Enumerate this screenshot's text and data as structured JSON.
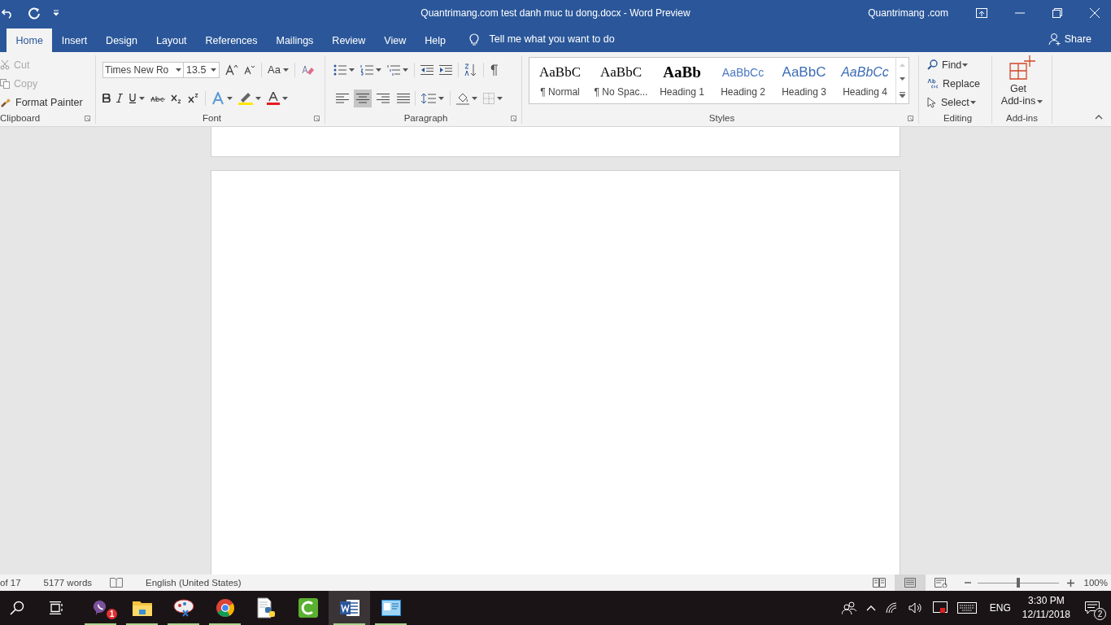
{
  "title_bar": {
    "title": "Quantrimang.com test danh muc tu dong.docx  -  Word Preview",
    "user": "Quantrimang .com"
  },
  "tabs": [
    {
      "label": "Home",
      "selected": true
    },
    {
      "label": "Insert",
      "selected": false
    },
    {
      "label": "Design",
      "selected": false
    },
    {
      "label": "Layout",
      "selected": false
    },
    {
      "label": "References",
      "selected": false
    },
    {
      "label": "Mailings",
      "selected": false
    },
    {
      "label": "Review",
      "selected": false
    },
    {
      "label": "View",
      "selected": false
    },
    {
      "label": "Help",
      "selected": false
    }
  ],
  "tell_me": "Tell me what you want to do",
  "share": "Share",
  "clipboard": {
    "label": "Clipboard",
    "items": [
      {
        "kind": "cut",
        "label": "Cut",
        "disabled": true
      },
      {
        "kind": "copy",
        "label": "Copy",
        "disabled": true
      },
      {
        "kind": "painter",
        "label": "Format Painter",
        "disabled": false
      }
    ]
  },
  "font": {
    "label": "Font",
    "font_name": "Times New Ro",
    "font_size": "13.5",
    "change_case": "Aa"
  },
  "paragraph": {
    "label": "Paragraph",
    "alignments": [
      {
        "selected": false
      },
      {
        "selected": true
      },
      {
        "selected": false
      },
      {
        "selected": false
      }
    ]
  },
  "styles": {
    "label": "Styles",
    "items": [
      {
        "kind": "normal",
        "preview": "AaBbC",
        "label": "¶ Normal"
      },
      {
        "kind": "normal",
        "preview": "AaBbC",
        "label": "¶ No Spac..."
      },
      {
        "kind": "heading1",
        "preview": "AaBb",
        "label": "Heading 1"
      },
      {
        "kind": "heading2",
        "preview": "AaBbCc",
        "label": "Heading 2"
      },
      {
        "kind": "heading3",
        "preview": "AaBbC",
        "label": "Heading 3"
      },
      {
        "kind": "heading4",
        "preview": "AaBbCc",
        "label": "Heading 4"
      }
    ]
  },
  "editing": {
    "label": "Editing",
    "items": [
      {
        "kind": "find",
        "label": "Find"
      },
      {
        "kind": "replace",
        "label": "Replace"
      },
      {
        "kind": "select",
        "label": "Select"
      }
    ]
  },
  "add_ins": {
    "label": "Add-ins",
    "button": [
      "Get",
      "Add-ins"
    ]
  },
  "status_bar": {
    "page": "of 17",
    "words": "5177 words",
    "language": "English (United States)",
    "views": [
      {
        "kind": "read",
        "selected": false
      },
      {
        "kind": "print",
        "selected": true
      },
      {
        "kind": "web",
        "selected": false
      }
    ],
    "zoom": {
      "level": 0.5,
      "reading": "100%"
    }
  },
  "taskbar": {
    "apps": [
      {
        "kind": "viber",
        "running": true,
        "active": false,
        "badge": "1"
      },
      {
        "kind": "folder",
        "running": true,
        "active": false
      },
      {
        "kind": "paint",
        "running": true,
        "active": false
      },
      {
        "kind": "chrome",
        "running": true,
        "active": false
      },
      {
        "kind": "python",
        "running": false,
        "active": false
      },
      {
        "kind": "camtasia",
        "running": false,
        "active": false
      },
      {
        "kind": "word",
        "running": true,
        "active": true
      },
      {
        "kind": "window",
        "running": true,
        "active": false
      }
    ],
    "language": "ENG",
    "time": "3:30 PM",
    "date": "12/11/2018",
    "notifications": "2"
  }
}
